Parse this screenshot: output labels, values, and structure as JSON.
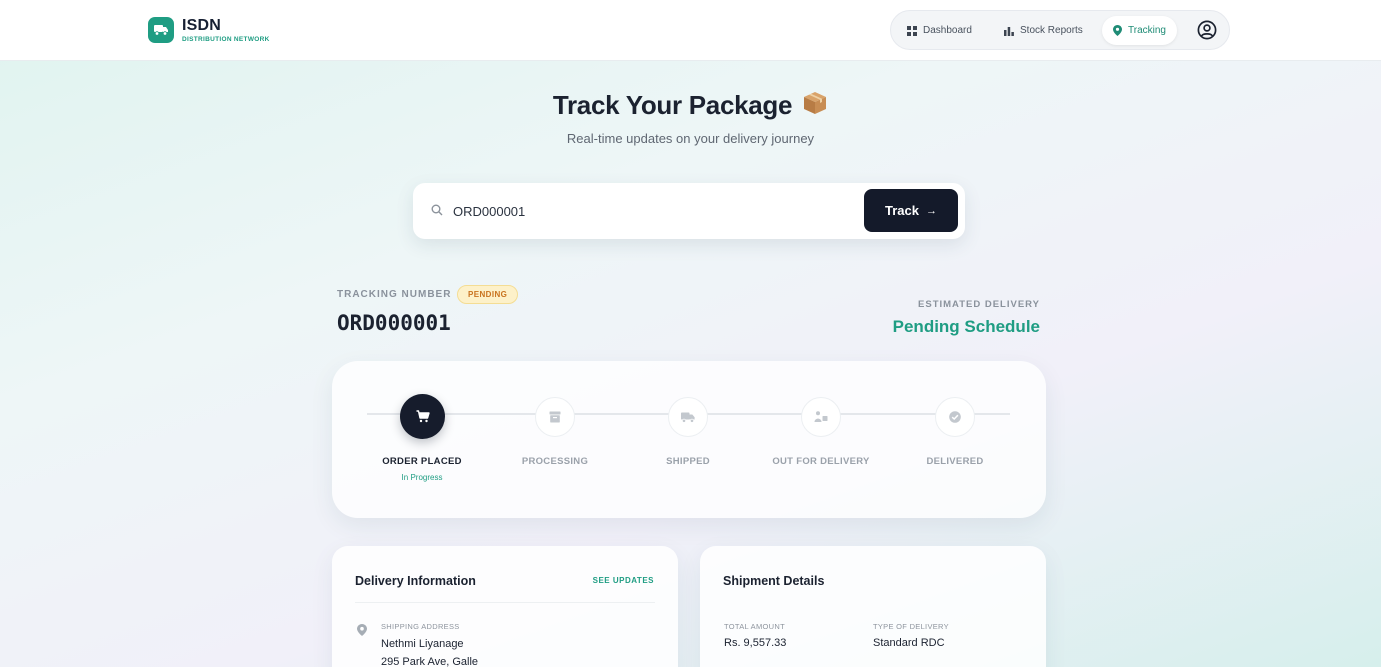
{
  "brand": {
    "name": "ISDN",
    "subtitle": "DISTRIBUTION NETWORK",
    "accent": "#1f9d83"
  },
  "nav": {
    "items": [
      {
        "label": "Dashboard",
        "icon": "grid-icon"
      },
      {
        "label": "Stock Reports",
        "icon": "bar-chart-icon"
      },
      {
        "label": "Tracking",
        "icon": "location-pin-icon",
        "active": true
      }
    ],
    "avatar_icon": "user-circle-icon"
  },
  "hero": {
    "title": "Track Your Package",
    "title_icon": "package-icon",
    "subtitle": "Real-time updates on your delivery journey"
  },
  "search": {
    "value": "ORD000001",
    "button_label": "Track",
    "button_arrow": "→"
  },
  "tracking": {
    "label": "TRACKING NUMBER",
    "status": "PENDING",
    "number": "ORD000001",
    "estimated_label": "ESTIMATED DELIVERY",
    "estimated_value": "Pending Schedule"
  },
  "steps": [
    {
      "label": "ORDER PLACED",
      "sub": "In Progress",
      "icon": "cart-icon",
      "active": true
    },
    {
      "label": "PROCESSING",
      "sub": "",
      "icon": "box-archive-icon",
      "active": false
    },
    {
      "label": "SHIPPED",
      "sub": "",
      "icon": "truck-icon",
      "active": false
    },
    {
      "label": "OUT FOR DELIVERY",
      "sub": "",
      "icon": "delivery-person-icon",
      "active": false
    },
    {
      "label": "DELIVERED",
      "sub": "",
      "icon": "check-circle-icon",
      "active": false
    }
  ],
  "delivery_info": {
    "title": "Delivery Information",
    "link": "SEE UPDATES",
    "address_label": "SHIPPING ADDRESS",
    "name": "Nethmi Liyanage",
    "address_line": "295 Park Ave, Galle"
  },
  "shipment": {
    "title": "Shipment Details",
    "total_label": "TOTAL AMOUNT",
    "total_value": "Rs. 9,557.33",
    "type_label": "TYPE OF DELIVERY",
    "type_value": "Standard RDC"
  }
}
